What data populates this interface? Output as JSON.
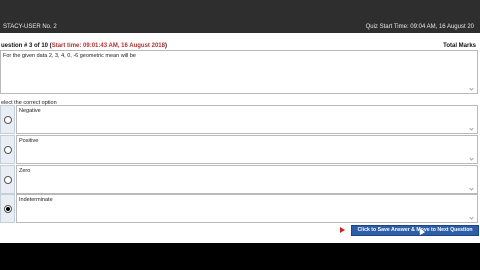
{
  "topbar": {
    "left_text": "STACY-USER No. 2",
    "right_text": "Quiz Start Time: 09:04 AM, 16 August 20"
  },
  "question": {
    "number_text": "uestion # 3 of 10 (",
    "start_time_text": "Start time: 09:01:43 AM, 16 August 2018",
    "close_text": ")",
    "total_marks_label": "Total Marks",
    "text": "For the given data 2, 3, 4, 0, -6 geometric mean will be"
  },
  "options_label": "elect the correct option",
  "options": [
    {
      "text": "Negative",
      "selected": false
    },
    {
      "text": "Positive",
      "selected": false
    },
    {
      "text": "Zero",
      "selected": false
    },
    {
      "text": "Indeterminate",
      "selected": true
    }
  ],
  "submit_button_label": "Click to Save Answer & Move to Next Question"
}
